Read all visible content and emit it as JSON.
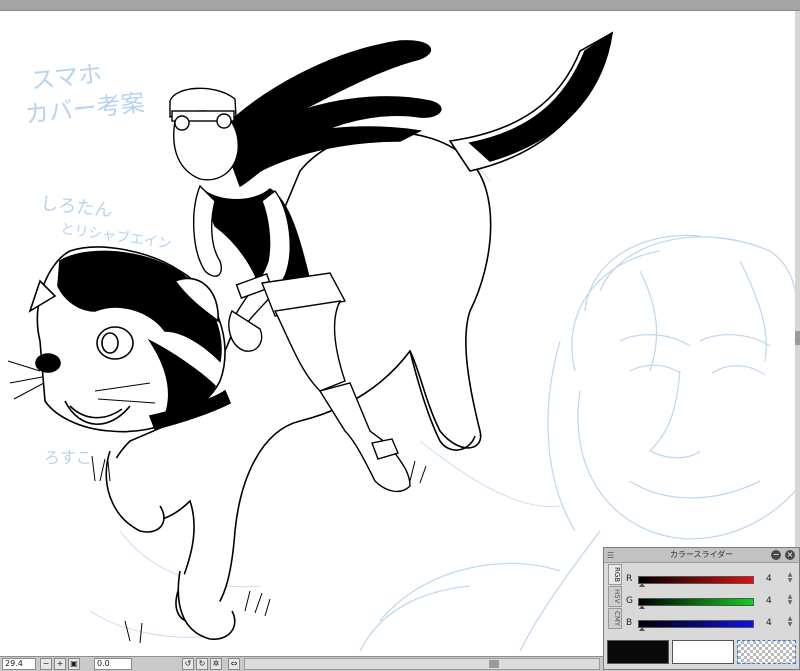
{
  "status_bar": {
    "zoom": "29.4",
    "angle": "0.0",
    "icons": [
      "zoom-out-icon",
      "zoom-in-icon",
      "fit-screen-icon",
      "rotate-left-icon",
      "rotate-right-icon",
      "reset-rotation-icon",
      "flip-icon"
    ]
  },
  "color_panel": {
    "title": "カラースライダー",
    "tabs": [
      "RGB",
      "HSV",
      "CMY"
    ],
    "active_tab": "RGB",
    "sliders": [
      {
        "label": "R",
        "value": "4",
        "color": "#e01010"
      },
      {
        "label": "G",
        "value": "4",
        "color": "#10d020"
      },
      {
        "label": "B",
        "value": "4",
        "color": "#1010e0"
      }
    ],
    "main_color": "#0a0a0a",
    "sub_color": "#ffffff"
  },
  "canvas": {
    "sketch_note_lines": [
      "スマホ",
      "カバー考案",
      "しろたん",
      "とリシャブエイン",
      "ろすこ"
    ],
    "sketch_color": "#b8d3ef",
    "ink_color": "#000000"
  }
}
